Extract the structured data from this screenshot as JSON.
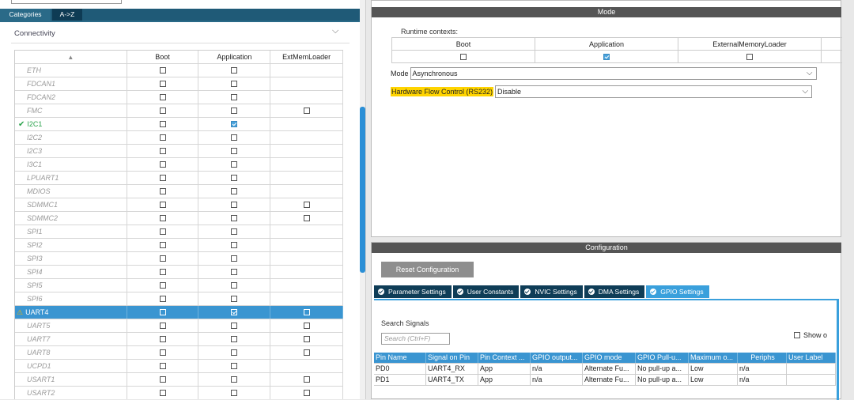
{
  "left_panel": {
    "tabs": [
      "Categories",
      "A->Z"
    ],
    "section_title": "Connectivity",
    "columns": [
      "",
      "Boot",
      "Application",
      "ExtMemLoader"
    ],
    "rows": [
      {
        "name": "ETH",
        "state": "disabled",
        "boot": false,
        "app": false,
        "ext": null
      },
      {
        "name": "FDCAN1",
        "state": "disabled",
        "boot": false,
        "app": false,
        "ext": null
      },
      {
        "name": "FDCAN2",
        "state": "disabled",
        "boot": false,
        "app": false,
        "ext": null
      },
      {
        "name": "FMC",
        "state": "disabled",
        "boot": false,
        "app": false,
        "ext": false
      },
      {
        "name": "I2C1",
        "state": "ok",
        "boot": false,
        "app": true,
        "ext": null
      },
      {
        "name": "I2C2",
        "state": "disabled",
        "boot": false,
        "app": false,
        "ext": null
      },
      {
        "name": "I2C3",
        "state": "disabled",
        "boot": false,
        "app": false,
        "ext": null
      },
      {
        "name": "I3C1",
        "state": "disabled",
        "boot": false,
        "app": false,
        "ext": null
      },
      {
        "name": "LPUART1",
        "state": "disabled",
        "boot": false,
        "app": false,
        "ext": null
      },
      {
        "name": "MDIOS",
        "state": "disabled",
        "boot": false,
        "app": false,
        "ext": null
      },
      {
        "name": "SDMMC1",
        "state": "disabled",
        "boot": false,
        "app": false,
        "ext": false
      },
      {
        "name": "SDMMC2",
        "state": "disabled",
        "boot": false,
        "app": false,
        "ext": false
      },
      {
        "name": "SPI1",
        "state": "disabled",
        "boot": false,
        "app": false,
        "ext": null
      },
      {
        "name": "SPI2",
        "state": "disabled",
        "boot": false,
        "app": false,
        "ext": null
      },
      {
        "name": "SPI3",
        "state": "disabled",
        "boot": false,
        "app": false,
        "ext": null
      },
      {
        "name": "SPI4",
        "state": "disabled",
        "boot": false,
        "app": false,
        "ext": null
      },
      {
        "name": "SPI5",
        "state": "disabled",
        "boot": false,
        "app": false,
        "ext": null
      },
      {
        "name": "SPI6",
        "state": "disabled",
        "boot": false,
        "app": false,
        "ext": null
      },
      {
        "name": "UART4",
        "state": "selected",
        "boot": false,
        "app": true,
        "ext": false
      },
      {
        "name": "UART5",
        "state": "disabled",
        "boot": false,
        "app": false,
        "ext": false
      },
      {
        "name": "UART7",
        "state": "disabled",
        "boot": false,
        "app": false,
        "ext": false
      },
      {
        "name": "UART8",
        "state": "disabled",
        "boot": false,
        "app": false,
        "ext": false
      },
      {
        "name": "UCPD1",
        "state": "disabled",
        "boot": false,
        "app": false,
        "ext": null
      },
      {
        "name": "USART1",
        "state": "disabled",
        "boot": false,
        "app": false,
        "ext": false
      },
      {
        "name": "USART2",
        "state": "disabled",
        "boot": false,
        "app": false,
        "ext": false
      }
    ]
  },
  "mode_panel": {
    "title": "Mode",
    "runtime_label": "Runtime contexts:",
    "runtime_columns": [
      "Boot",
      "Application",
      "ExternalMemoryLoader"
    ],
    "runtime_values": [
      false,
      true,
      false
    ],
    "mode_label": "Mode",
    "mode_value": "Asynchronous",
    "hwfc_label": "Hardware Flow Control (RS232)",
    "hwfc_value": "Disable"
  },
  "config_panel": {
    "title": "Configuration",
    "reset_label": "Reset Configuration",
    "tabs": [
      "Parameter Settings",
      "User Constants",
      "NVIC Settings",
      "DMA Settings",
      "GPIO Settings"
    ],
    "active_tab": 4,
    "search_title": "Search Signals",
    "search_placeholder": "Search (Ctrl+F)",
    "show_only_label": "Show o",
    "table_headers": [
      "Pin Name",
      "Signal on Pin",
      "Pin Context ...",
      "GPIO output...",
      "GPIO mode",
      "GPIO Pull-u...",
      "Maximum o...",
      "Periphs",
      "User Label"
    ],
    "table_rows": [
      [
        "PD0",
        "UART4_RX",
        "App",
        "n/a",
        "Alternate Fu...",
        "No pull-up a...",
        "Low",
        "n/a",
        ""
      ],
      [
        "PD1",
        "UART4_TX",
        "App",
        "n/a",
        "Alternate Fu...",
        "No pull-up a...",
        "Low",
        "n/a",
        ""
      ]
    ]
  },
  "icons": {
    "sort": "sort-icon",
    "chevron": "chevron-down-icon",
    "check": "check-icon",
    "warning": "warning-icon",
    "tab_check": "circle-check-icon"
  },
  "colors": {
    "tab_bar": "#1f5a77",
    "selection": "#3a95d1",
    "ok_green": "#2da44e",
    "highlight": "#ffd400",
    "panel_bar": "#555555"
  }
}
